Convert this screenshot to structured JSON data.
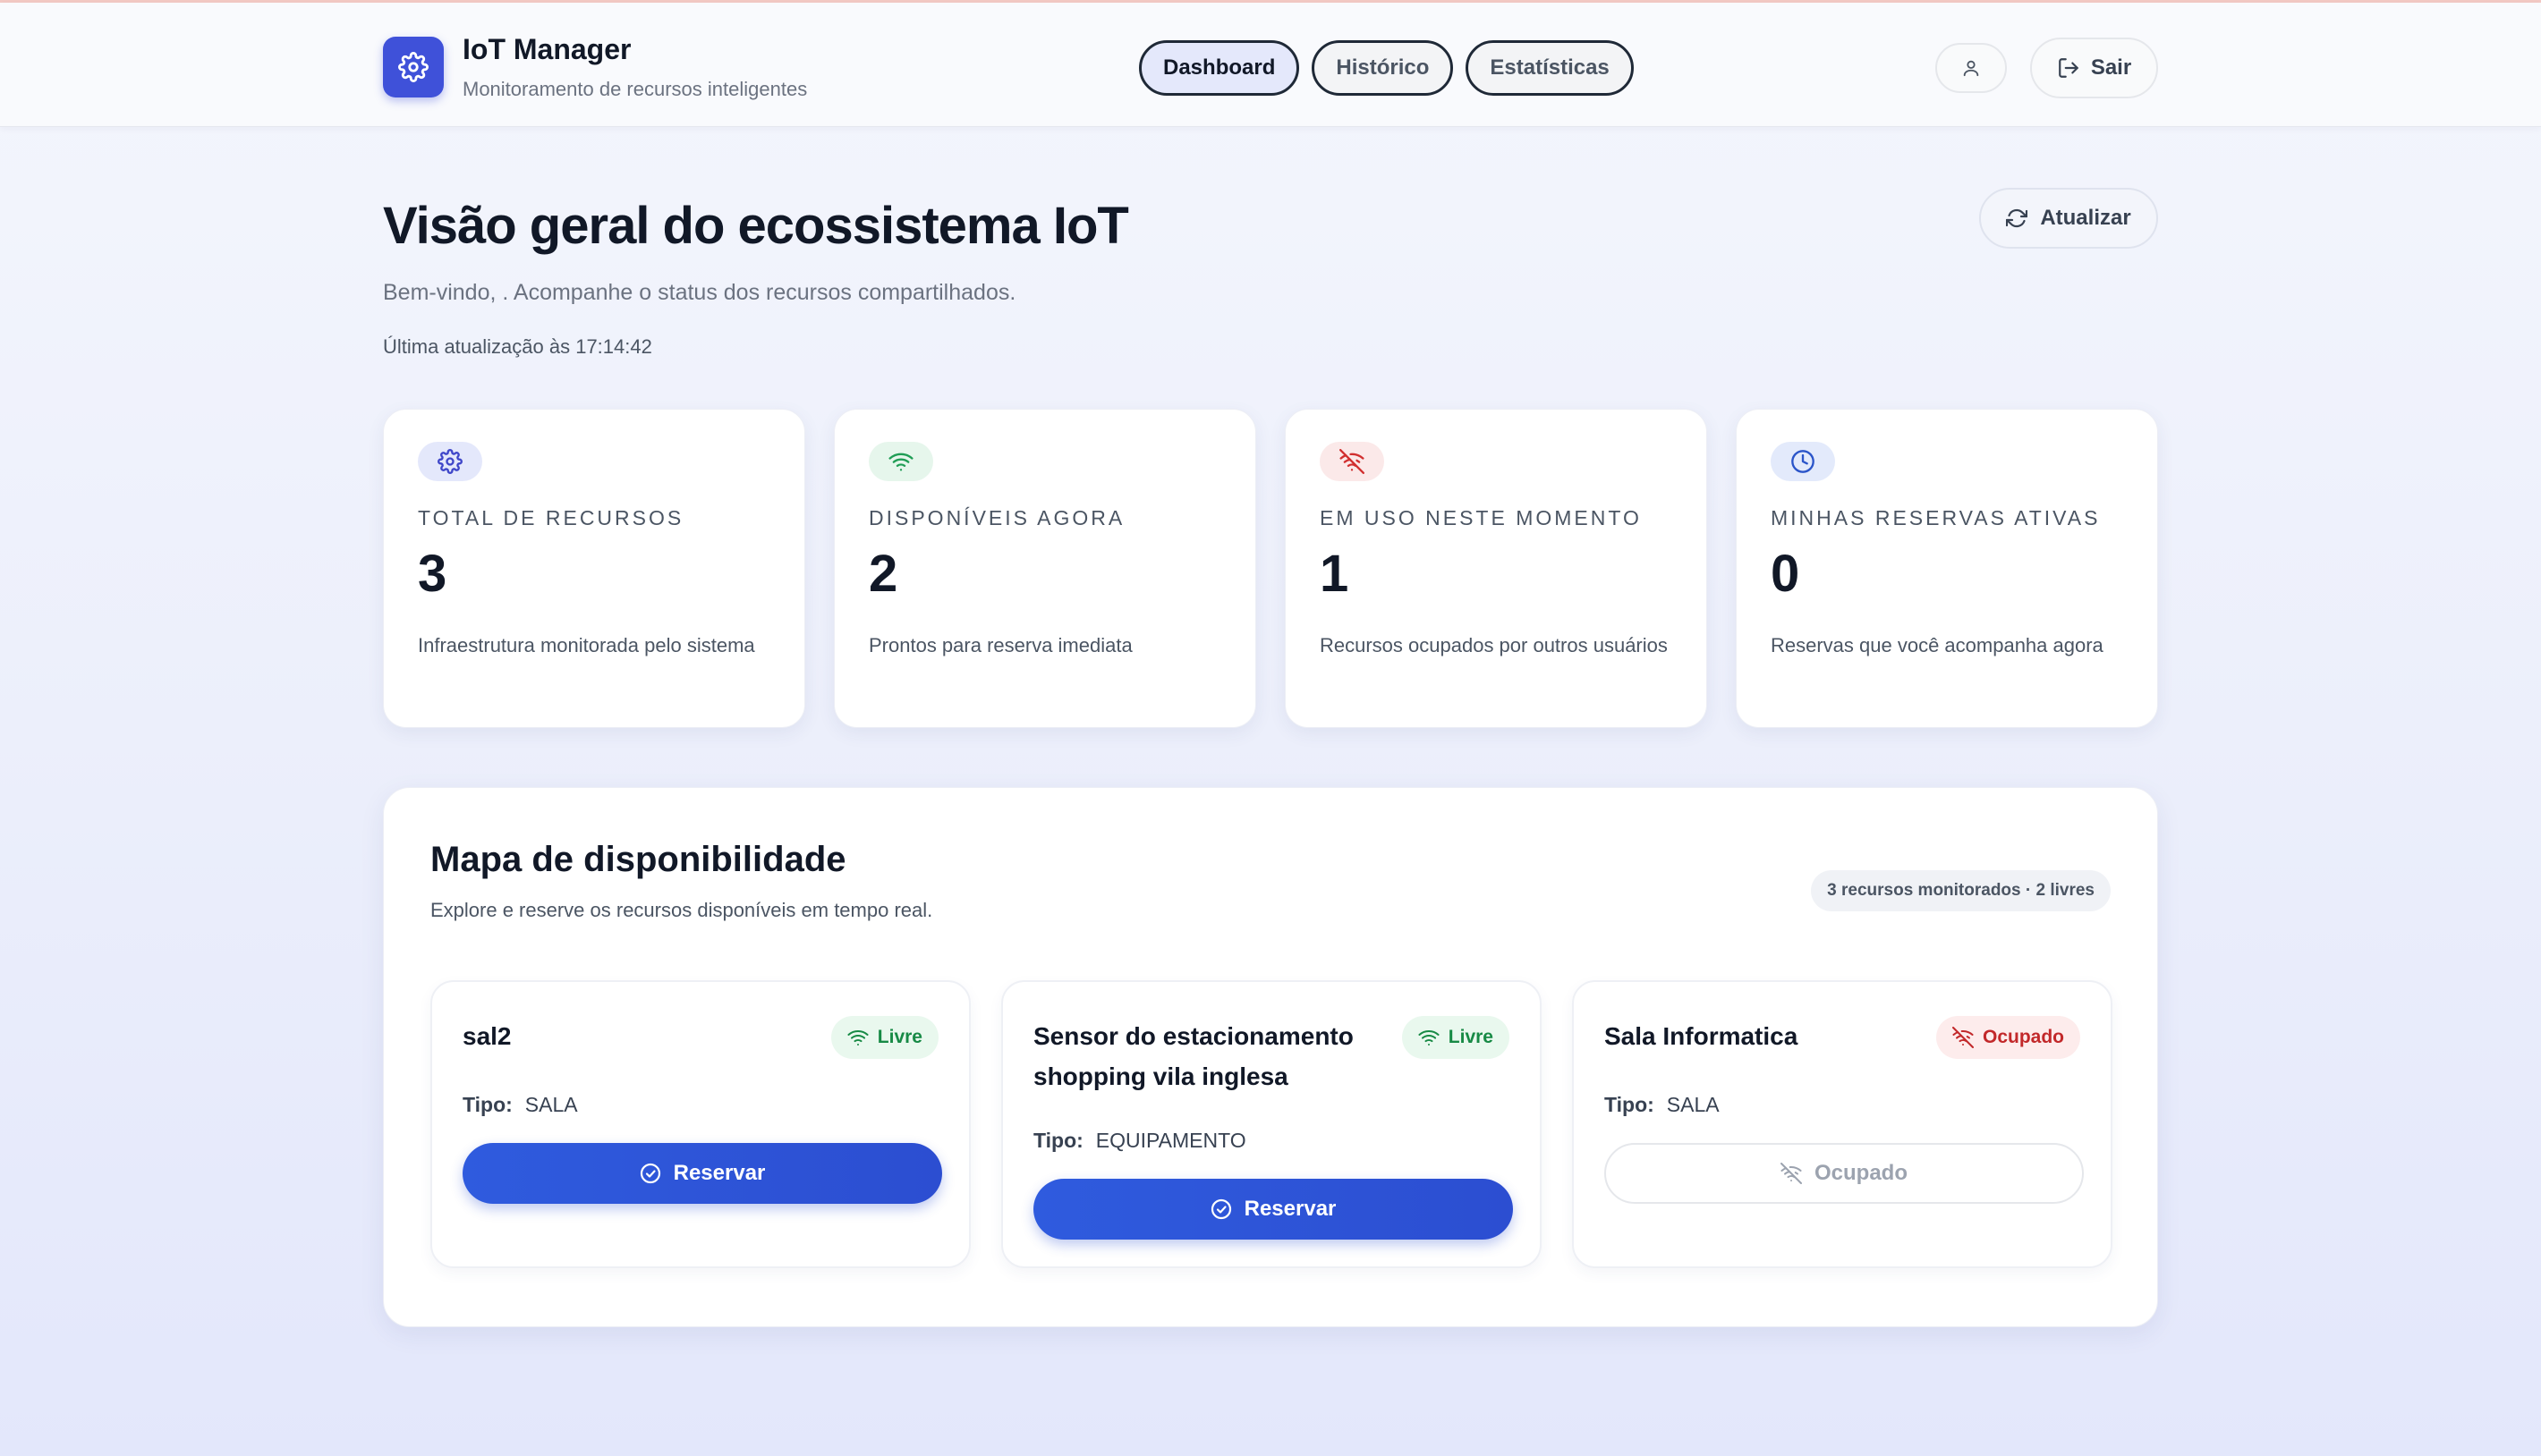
{
  "app": {
    "title": "IoT Manager",
    "subtitle": "Monitoramento de recursos inteligentes",
    "brand_icon": "gear-icon",
    "accent": "#3f51d9"
  },
  "nav": {
    "tabs": [
      {
        "label": "Dashboard",
        "active": true
      },
      {
        "label": "Histórico",
        "active": false
      },
      {
        "label": "Estatísticas",
        "active": false
      }
    ]
  },
  "header_actions": {
    "user_icon": "user-icon",
    "logout_label": "Sair"
  },
  "page": {
    "title": "Visão geral do ecossistema IoT",
    "subtitle": "Bem-vindo, . Acompanhe o status dos recursos compartilhados.",
    "last_update": "Última atualização às 17:14:42",
    "refresh_label": "Atualizar"
  },
  "stats": [
    {
      "icon": "gear-icon",
      "label": "TOTAL DE RECURSOS",
      "value": "3",
      "description": "Infraestrutura monitorada pelo sistema",
      "color": "#3f47c9"
    },
    {
      "icon": "wifi-icon",
      "label": "DISPONÍVEIS AGORA",
      "value": "2",
      "description": "Prontos para reserva imediata",
      "color": "#1f9d55"
    },
    {
      "icon": "wifi-off-icon",
      "label": "EM USO NESTE MOMENTO",
      "value": "1",
      "description": "Recursos ocupados por outros usuários",
      "color": "#d12f2f"
    },
    {
      "icon": "clock-icon",
      "label": "MINHAS RESERVAS ATIVAS",
      "value": "0",
      "description": "Reservas que você acompanha agora",
      "color": "#2b55c9"
    }
  ],
  "map": {
    "title": "Mapa de disponibilidade",
    "subtitle": "Explore e reserve os recursos disponíveis em tempo real.",
    "badge": "3 recursos monitorados · 2 livres",
    "resources": [
      {
        "name": "sal2",
        "status": "Livre",
        "type_label": "Tipo:",
        "type": "SALA",
        "action": "Reservar"
      },
      {
        "name": "Sensor do estacionamento shopping vila inglesa",
        "status": "Livre",
        "type_label": "Tipo:",
        "type": "EQUIPAMENTO",
        "action": "Reservar"
      },
      {
        "name": "Sala Informatica",
        "status": "Ocupado",
        "type_label": "Tipo:",
        "type": "SALA",
        "action": "Ocupado"
      }
    ]
  }
}
